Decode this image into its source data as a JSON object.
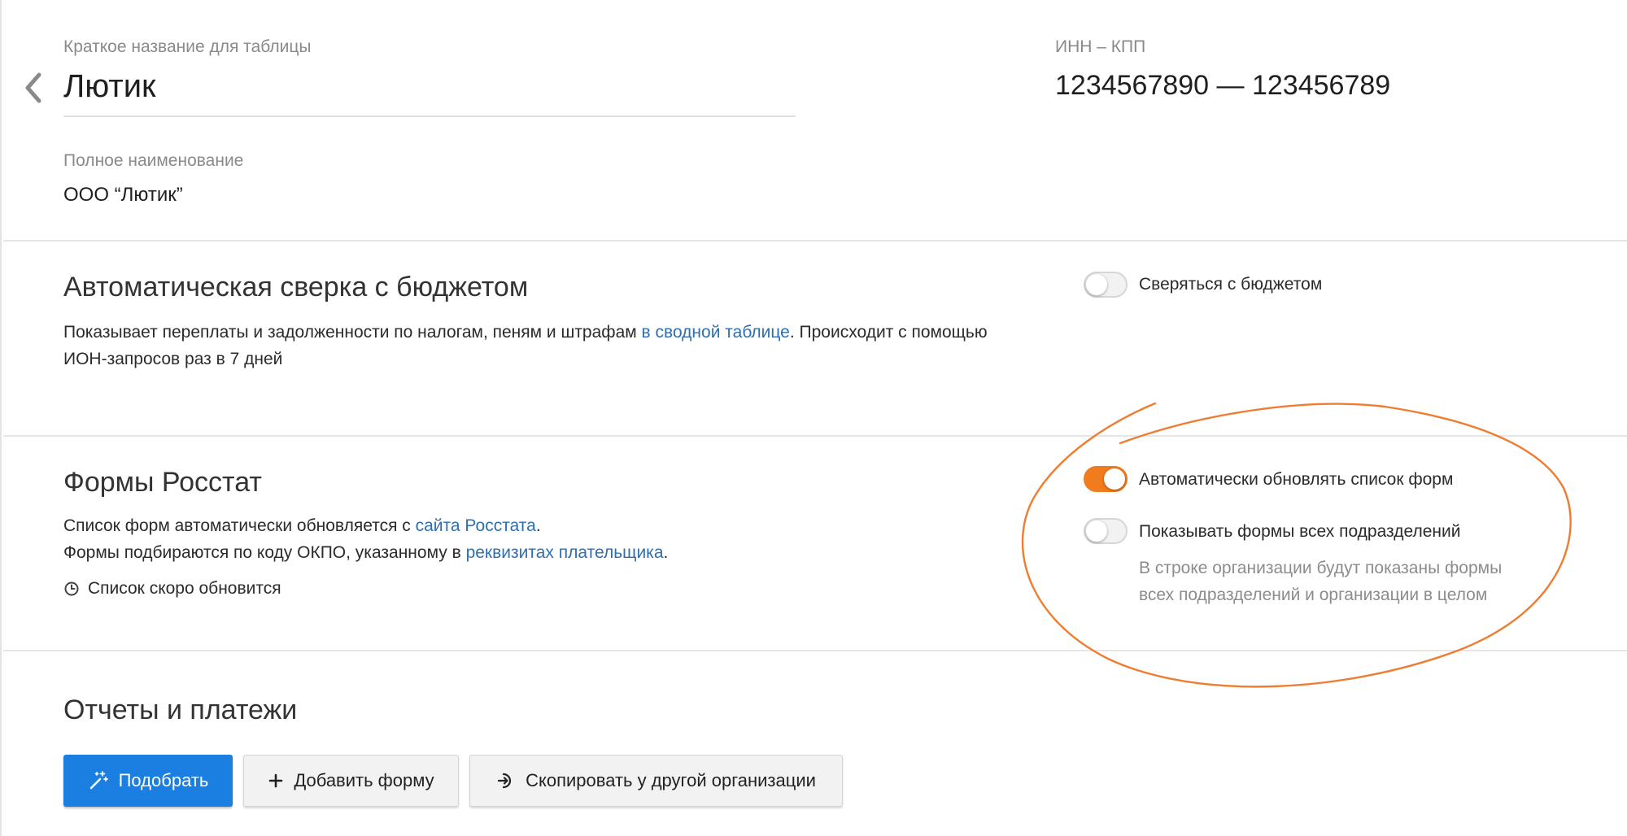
{
  "org": {
    "short_name_label": "Краткое название для таблицы",
    "short_name": "Лютик",
    "inn_kpp_label": "ИНН – КПП",
    "inn_kpp": "1234567890 — 123456789",
    "full_name_label": "Полное наименование",
    "full_name": "ООО “Лютик”"
  },
  "budget": {
    "title": "Автоматическая сверка с бюджетом",
    "desc_part1": "Показывает переплаты и задолженности по налогам, пеням и штрафам ",
    "desc_link": "в сводной таблице",
    "desc_part2": ". Происходит с помощью",
    "desc_line2": "ИОН-запросов раз в 7 дней",
    "toggle_label": "Сверяться с бюджетом",
    "toggle_on": false
  },
  "rosstat": {
    "title": "Формы Росстат",
    "line1_part1": "Список форм автоматически обновляется с ",
    "line1_link": "сайта Росстата",
    "line1_part2": ".",
    "line2_part1": "Формы подбираются по коду ОКПО, указанному в ",
    "line2_link": "реквизитах плательщика",
    "line2_part2": ".",
    "status": "Список скоро обновится",
    "auto_update_label": "Автоматически обновлять список форм",
    "auto_update_on": true,
    "show_all_label": "Показывать формы всех подразделений",
    "show_all_on": false,
    "hint_line1": "В строке организации будут показаны формы",
    "hint_line2": "всех подразделений и организации в целом"
  },
  "reports": {
    "title": "Отчеты и платежи",
    "pick_button": "Подобрать",
    "add_button": "Добавить форму",
    "copy_button": "Скопировать у другой организации"
  },
  "colors": {
    "accent": "#f07c1e",
    "primary": "#1a7fe0",
    "link": "#2f6fb1"
  }
}
